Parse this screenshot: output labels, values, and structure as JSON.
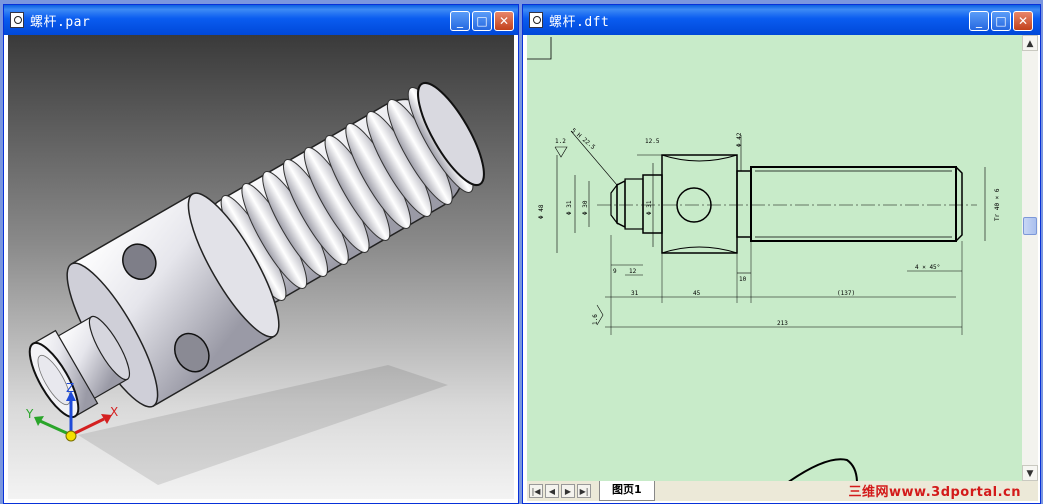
{
  "left_window": {
    "title": "螺杆.par",
    "controls": {
      "minimize": "_",
      "maximize": "□",
      "close": "✕"
    },
    "triad": {
      "x_label": "X",
      "y_label": "Y",
      "z_label": "Z",
      "x_color": "#d42020",
      "y_color": "#2aa52a",
      "z_color": "#1e4ad8"
    }
  },
  "right_window": {
    "title": "螺杆.dft",
    "controls": {
      "minimize": "_",
      "maximize": "□",
      "close": "✕"
    },
    "sheet_tab": "图页1",
    "dimensions": {
      "d1": "5 H 22.5",
      "d2": "1.2",
      "d3": "12.5",
      "d4": "Φ 42",
      "d5": "Φ 48",
      "d6": "Φ 31",
      "d7": "Φ 30",
      "d8": "Φ 31",
      "d9": "Tr 40 × 6",
      "d10": "9",
      "d11": "12",
      "d12": "10",
      "d13": "4 × 45°",
      "d14": "31",
      "d15": "45",
      "d16": "(137)",
      "d17": "213",
      "d18": "1.6"
    },
    "sheet_color": "#c8ebc9"
  },
  "watermark": "三维网www.3dportal.cn",
  "colors": {
    "titlebar": "#0a5cf0",
    "desktop": "#7a96df",
    "watermark": "#d31a1a"
  }
}
